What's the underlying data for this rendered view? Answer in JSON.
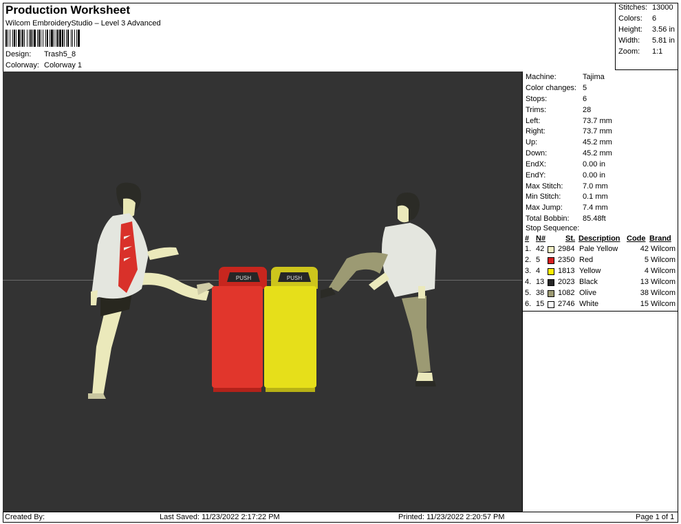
{
  "header": {
    "title": "Production Worksheet",
    "subtitle": "Wilcom EmbroideryStudio – Level 3 Advanced",
    "design_label": "Design:",
    "design_value": "Trash5_8",
    "colorway_label": "Colorway:",
    "colorway_value": "Colorway 1"
  },
  "stats": [
    {
      "label": "Stitches:",
      "value": "13000"
    },
    {
      "label": "Colors:",
      "value": "6"
    },
    {
      "label": "Height:",
      "value": "3.56 in"
    },
    {
      "label": "Width:",
      "value": "5.81 in"
    },
    {
      "label": "Zoom:",
      "value": "1:1"
    }
  ],
  "machine_info": [
    {
      "label": "Machine:",
      "value": "Tajima"
    },
    {
      "label": "Color changes:",
      "value": "5"
    },
    {
      "label": "Stops:",
      "value": "6"
    },
    {
      "label": "Trims:",
      "value": "28"
    },
    {
      "label": "Left:",
      "value": "73.7 mm"
    },
    {
      "label": "Right:",
      "value": "73.7 mm"
    },
    {
      "label": "Up:",
      "value": "45.2 mm"
    },
    {
      "label": "Down:",
      "value": "45.2 mm"
    },
    {
      "label": "EndX:",
      "value": "0.00 in"
    },
    {
      "label": "EndY:",
      "value": "0.00 in"
    },
    {
      "label": "Max Stitch:",
      "value": "7.0 mm"
    },
    {
      "label": "Min Stitch:",
      "value": "0.1 mm"
    },
    {
      "label": "Max Jump:",
      "value": "7.4 mm"
    },
    {
      "label": "Total Bobbin:",
      "value": "85.48ft"
    }
  ],
  "stop_sequence": {
    "title": "Stop Sequence:",
    "columns": [
      "#",
      "N#",
      "St.",
      "Description",
      "Code",
      "Brand"
    ],
    "rows": [
      {
        "num": "1.",
        "n": "42",
        "color": "#f3f1c4",
        "st": "2984",
        "description": "Pale Yellow",
        "code": "42",
        "brand": "Wilcom"
      },
      {
        "num": "2.",
        "n": "5",
        "color": "#d81f1f",
        "st": "2350",
        "description": "Red",
        "code": "5",
        "brand": "Wilcom"
      },
      {
        "num": "3.",
        "n": "4",
        "color": "#ffee00",
        "st": "1813",
        "description": "Yellow",
        "code": "4",
        "brand": "Wilcom"
      },
      {
        "num": "4.",
        "n": "13",
        "color": "#262626",
        "st": "2023",
        "description": "Black",
        "code": "13",
        "brand": "Wilcom"
      },
      {
        "num": "5.",
        "n": "38",
        "color": "#9c9a73",
        "st": "1082",
        "description": "Olive",
        "code": "38",
        "brand": "Wilcom"
      },
      {
        "num": "6.",
        "n": "15",
        "color": "#ffffff",
        "st": "2746",
        "description": "White",
        "code": "15",
        "brand": "Wilcom"
      }
    ]
  },
  "design": {
    "background": "#333333",
    "bin_label": "PUSH"
  },
  "footer": {
    "created_by": "Created By:",
    "last_saved": "Last Saved: 11/23/2022 2:17:22 PM",
    "printed": "Printed: 11/23/2022 2:20:57 PM",
    "page": "Page 1 of 1"
  }
}
